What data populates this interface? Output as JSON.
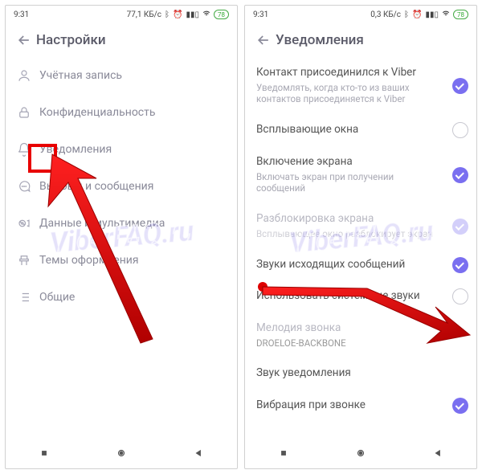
{
  "status": {
    "time": "9:31",
    "net_left": "77,1 КБ/с",
    "net_right": "0,3 КБ/с",
    "battery": "78"
  },
  "left": {
    "title": "Настройки",
    "items": [
      {
        "label": "Учётная запись",
        "icon": "user"
      },
      {
        "label": "Конфиденциальность",
        "icon": "lock"
      },
      {
        "label": "Уведомления",
        "icon": "bell"
      },
      {
        "label": "Вызовы и сообщения",
        "icon": "message"
      },
      {
        "label": "Данные и мультимедиа",
        "icon": "media"
      },
      {
        "label": "Темы оформления",
        "icon": "theme"
      },
      {
        "label": "Общие",
        "icon": "list"
      }
    ]
  },
  "right": {
    "title": "Уведомления",
    "rows": [
      {
        "title": "Контакт присоединился к Viber",
        "sub": "Уведомлять, когда кто-то из ваших контактов присоединяется к Viber",
        "state": "checked"
      },
      {
        "title": "Всплывающие окна",
        "sub": "",
        "state": "unchecked"
      },
      {
        "title": "Включение экрана",
        "sub": "Включать экран при получении сообщений",
        "state": "checked"
      },
      {
        "title": "Разблокировка экрана",
        "sub": "Всплывающее окно разблокирует экран",
        "state": "checked-disabled",
        "disabled": true
      },
      {
        "title": "Звуки исходящих сообщений",
        "sub": "",
        "state": "checked"
      },
      {
        "title": "Использовать системные звуки",
        "sub": "",
        "state": "unchecked"
      },
      {
        "title": "Мелодия звонка",
        "sub": "DROELOE-BACKBONE",
        "state": "",
        "disabled": true
      },
      {
        "title": "Звук уведомления",
        "sub": "",
        "state": ""
      },
      {
        "title": "Вибрация при звонке",
        "sub": "",
        "state": "checked"
      }
    ]
  },
  "watermark": "ViberFAQ.ru"
}
